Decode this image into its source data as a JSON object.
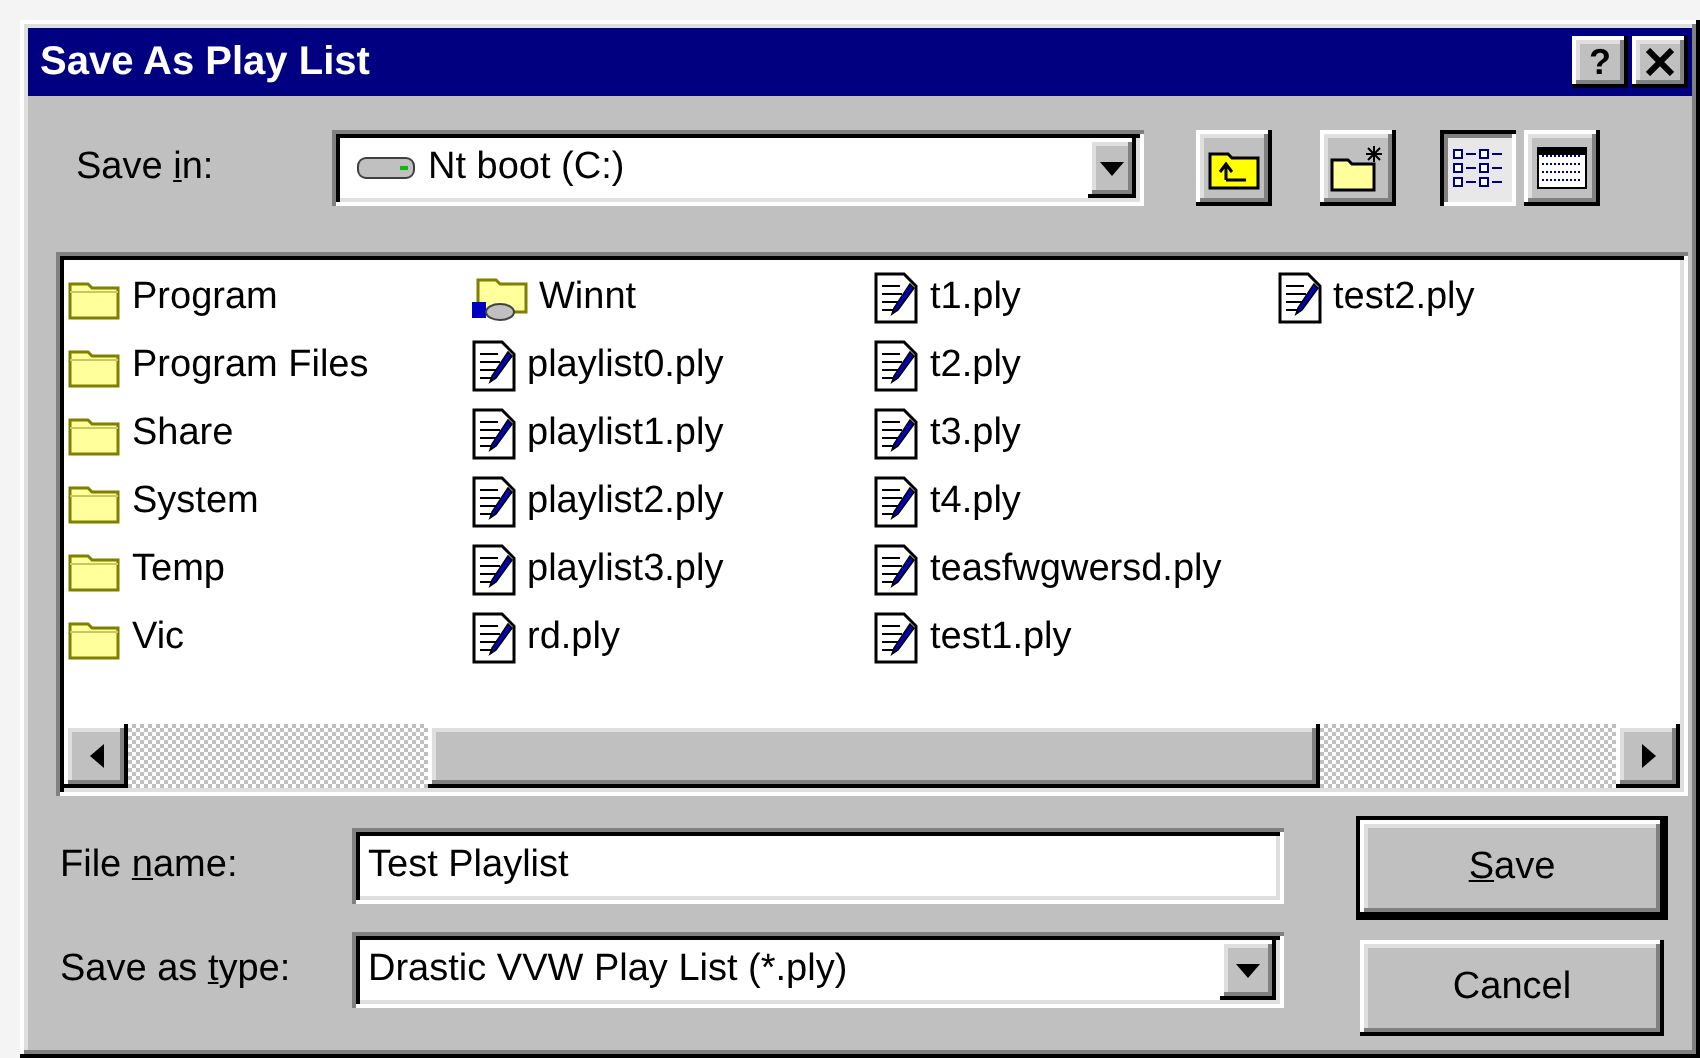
{
  "window": {
    "title": "Save As Play List",
    "help": "?"
  },
  "save_in": {
    "label_parts": [
      "Save ",
      "i",
      "n:"
    ],
    "value": "Nt boot (C:)"
  },
  "view_buttons": [
    {
      "kind": "list",
      "selected": true
    },
    {
      "kind": "details",
      "selected": false
    }
  ],
  "file_columns": [
    [
      {
        "kind": "folder",
        "name": "Program"
      },
      {
        "kind": "folder",
        "name": "Program Files"
      },
      {
        "kind": "folder",
        "name": "Share"
      },
      {
        "kind": "folder",
        "name": "System"
      },
      {
        "kind": "folder",
        "name": "Temp"
      },
      {
        "kind": "folder",
        "name": "Vic"
      }
    ],
    [
      {
        "kind": "system-folder",
        "name": "Winnt"
      },
      {
        "kind": "file",
        "name": "playlist0.ply"
      },
      {
        "kind": "file",
        "name": "playlist1.ply"
      },
      {
        "kind": "file",
        "name": "playlist2.ply"
      },
      {
        "kind": "file",
        "name": "playlist3.ply"
      },
      {
        "kind": "file",
        "name": "rd.ply"
      }
    ],
    [
      {
        "kind": "file",
        "name": "t1.ply"
      },
      {
        "kind": "file",
        "name": "t2.ply"
      },
      {
        "kind": "file",
        "name": "t3.ply"
      },
      {
        "kind": "file",
        "name": "t4.ply"
      },
      {
        "kind": "file",
        "name": "teasfwgwersd.ply"
      },
      {
        "kind": "file",
        "name": "test1.ply"
      }
    ],
    [
      {
        "kind": "file",
        "name": "test2.ply"
      }
    ]
  ],
  "file_name": {
    "label_parts": [
      "File ",
      "n",
      "ame:"
    ],
    "value": "Test Playlist"
  },
  "save_as_type": {
    "label_parts": [
      "Save as ",
      "t",
      "ype:"
    ],
    "value": "Drastic VVW Play List (*.ply)"
  },
  "buttons": [
    {
      "label": {
        "key": "S",
        "tail": "ave"
      },
      "default": true
    },
    {
      "label": {
        "lead": "Cancel"
      },
      "default": false
    }
  ]
}
